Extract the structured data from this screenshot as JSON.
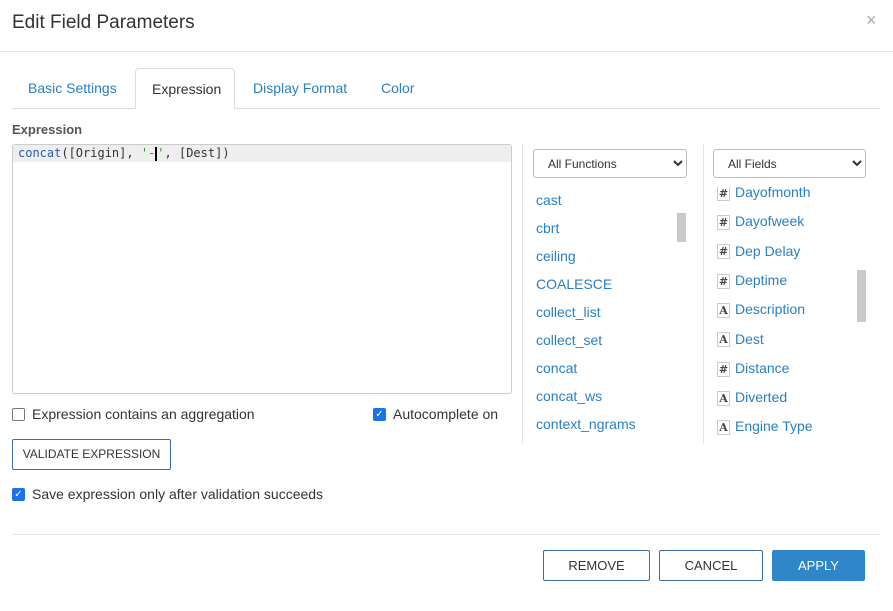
{
  "dialog": {
    "title": "Edit Field Parameters",
    "close": "×"
  },
  "tabs": [
    {
      "label": "Basic Settings"
    },
    {
      "label": "Expression"
    },
    {
      "label": "Display Format"
    },
    {
      "label": "Color"
    }
  ],
  "expression": {
    "label": "Expression",
    "code_fn": "concat",
    "code_a": "([Origin], ",
    "code_str1": "'-",
    "code_str2": "'",
    "code_b": ", [Dest])"
  },
  "functions": {
    "selected": "All Functions",
    "items": [
      "cast",
      "cbrt",
      "ceiling",
      "COALESCE",
      "collect_list",
      "collect_set",
      "concat",
      "concat_ws",
      "context_ngrams"
    ]
  },
  "fields": {
    "selected": "All Fields",
    "items": [
      {
        "type": "#",
        "name": "Dayofmonth"
      },
      {
        "type": "#",
        "name": "Dayofweek"
      },
      {
        "type": "#",
        "name": "Dep Delay"
      },
      {
        "type": "#",
        "name": "Deptime"
      },
      {
        "type": "A",
        "name": "Description"
      },
      {
        "type": "A",
        "name": "Dest"
      },
      {
        "type": "#",
        "name": "Distance"
      },
      {
        "type": "A",
        "name": "Diverted"
      },
      {
        "type": "A",
        "name": "Engine Type"
      }
    ]
  },
  "options": {
    "aggregation": "Expression contains an aggregation",
    "autocomplete": "Autocomplete on",
    "validate": "VALIDATE EXPRESSION",
    "save_after": "Save expression only after validation succeeds",
    "check": "✓"
  },
  "footer": {
    "remove": "REMOVE",
    "cancel": "CANCEL",
    "apply": "APPLY"
  }
}
